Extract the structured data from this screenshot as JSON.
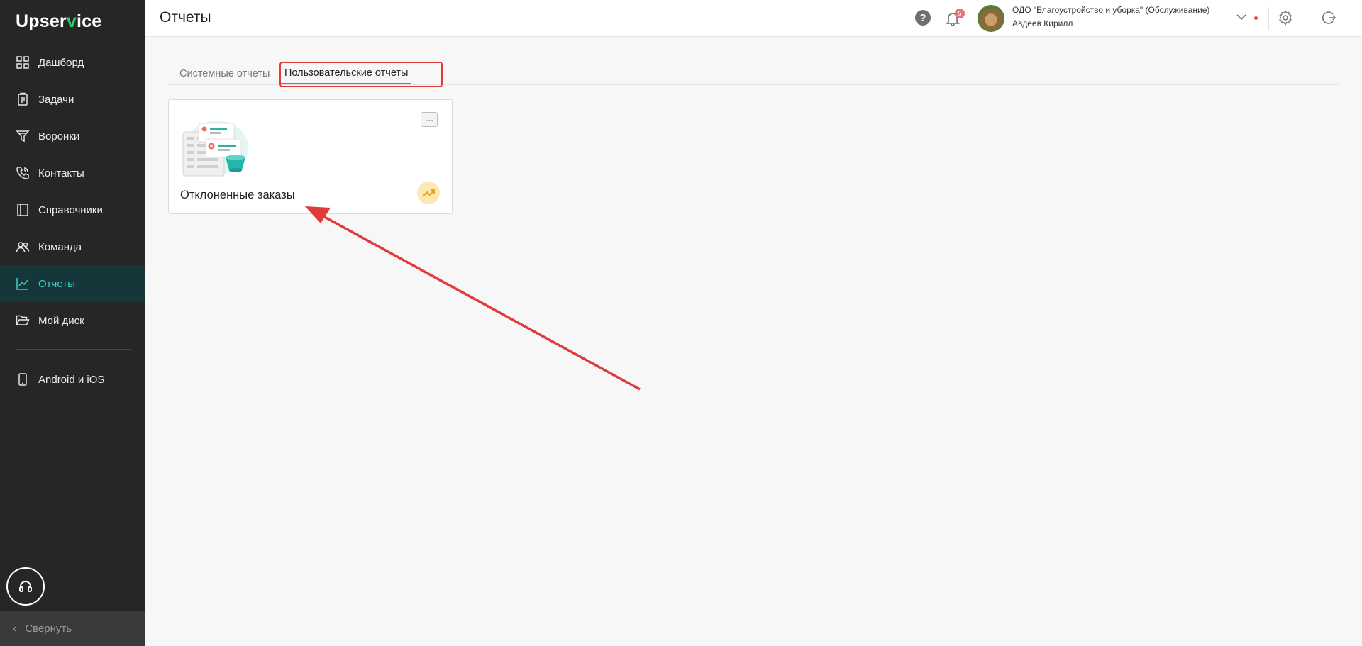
{
  "app": {
    "logo_pre": "Upser",
    "logo_v": "v",
    "logo_post": "ice"
  },
  "sidebar": {
    "items": [
      {
        "label": "Дашборд",
        "icon": "dashboard-icon"
      },
      {
        "label": "Задачи",
        "icon": "tasks-icon"
      },
      {
        "label": "Воронки",
        "icon": "funnel-icon"
      },
      {
        "label": "Контакты",
        "icon": "phone-icon"
      },
      {
        "label": "Справочники",
        "icon": "book-icon"
      },
      {
        "label": "Команда",
        "icon": "team-icon"
      },
      {
        "label": "Отчеты",
        "icon": "chart-icon",
        "active": true
      },
      {
        "label": "Мой диск",
        "icon": "folder-icon"
      },
      {
        "label": "Android и iOS",
        "icon": "mobile-icon"
      }
    ],
    "collapse_label": "Свернуть",
    "collapse_icon": "chevron-left-icon",
    "support_icon": "headset-icon"
  },
  "header": {
    "title": "Отчеты",
    "notifications_count": "5",
    "org": "ОДО \"Благоустройство и уборка\" (Обслуживание)",
    "user": "Авдеев Кирилл",
    "help_glyph": "?",
    "accent_color": "#1ca99e",
    "active_nav_color": "#3ccfc4"
  },
  "tabs": {
    "system": "Системные отчеты",
    "user": "Пользовательские отчеты",
    "selected": "user"
  },
  "cards": [
    {
      "title": "Отклоненные заказы",
      "menu_glyph": "···",
      "badge_icon": "trend-up-icon"
    }
  ],
  "annotation": {
    "highlight_color": "#e03a3a"
  }
}
